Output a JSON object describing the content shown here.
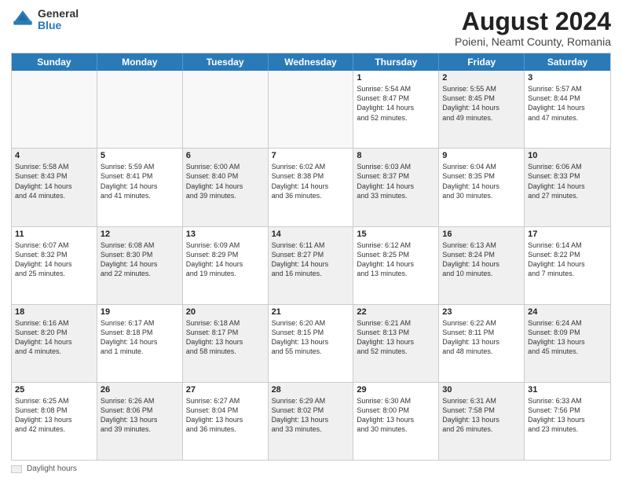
{
  "header": {
    "logo_general": "General",
    "logo_blue": "Blue",
    "month_title": "August 2024",
    "subtitle": "Poieni, Neamt County, Romania"
  },
  "days_of_week": [
    "Sunday",
    "Monday",
    "Tuesday",
    "Wednesday",
    "Thursday",
    "Friday",
    "Saturday"
  ],
  "rows": [
    {
      "cells": [
        {
          "day": "",
          "text": "",
          "empty": true
        },
        {
          "day": "",
          "text": "",
          "empty": true
        },
        {
          "day": "",
          "text": "",
          "empty": true
        },
        {
          "day": "",
          "text": "",
          "empty": true
        },
        {
          "day": "1",
          "text": "Sunrise: 5:54 AM\nSunset: 8:47 PM\nDaylight: 14 hours\nand 52 minutes.",
          "shaded": false
        },
        {
          "day": "2",
          "text": "Sunrise: 5:55 AM\nSunset: 8:45 PM\nDaylight: 14 hours\nand 49 minutes.",
          "shaded": true
        },
        {
          "day": "3",
          "text": "Sunrise: 5:57 AM\nSunset: 8:44 PM\nDaylight: 14 hours\nand 47 minutes.",
          "shaded": false
        }
      ]
    },
    {
      "cells": [
        {
          "day": "4",
          "text": "Sunrise: 5:58 AM\nSunset: 8:43 PM\nDaylight: 14 hours\nand 44 minutes.",
          "shaded": true
        },
        {
          "day": "5",
          "text": "Sunrise: 5:59 AM\nSunset: 8:41 PM\nDaylight: 14 hours\nand 41 minutes.",
          "shaded": false
        },
        {
          "day": "6",
          "text": "Sunrise: 6:00 AM\nSunset: 8:40 PM\nDaylight: 14 hours\nand 39 minutes.",
          "shaded": true
        },
        {
          "day": "7",
          "text": "Sunrise: 6:02 AM\nSunset: 8:38 PM\nDaylight: 14 hours\nand 36 minutes.",
          "shaded": false
        },
        {
          "day": "8",
          "text": "Sunrise: 6:03 AM\nSunset: 8:37 PM\nDaylight: 14 hours\nand 33 minutes.",
          "shaded": true
        },
        {
          "day": "9",
          "text": "Sunrise: 6:04 AM\nSunset: 8:35 PM\nDaylight: 14 hours\nand 30 minutes.",
          "shaded": false
        },
        {
          "day": "10",
          "text": "Sunrise: 6:06 AM\nSunset: 8:33 PM\nDaylight: 14 hours\nand 27 minutes.",
          "shaded": true
        }
      ]
    },
    {
      "cells": [
        {
          "day": "11",
          "text": "Sunrise: 6:07 AM\nSunset: 8:32 PM\nDaylight: 14 hours\nand 25 minutes.",
          "shaded": false
        },
        {
          "day": "12",
          "text": "Sunrise: 6:08 AM\nSunset: 8:30 PM\nDaylight: 14 hours\nand 22 minutes.",
          "shaded": true
        },
        {
          "day": "13",
          "text": "Sunrise: 6:09 AM\nSunset: 8:29 PM\nDaylight: 14 hours\nand 19 minutes.",
          "shaded": false
        },
        {
          "day": "14",
          "text": "Sunrise: 6:11 AM\nSunset: 8:27 PM\nDaylight: 14 hours\nand 16 minutes.",
          "shaded": true
        },
        {
          "day": "15",
          "text": "Sunrise: 6:12 AM\nSunset: 8:25 PM\nDaylight: 14 hours\nand 13 minutes.",
          "shaded": false
        },
        {
          "day": "16",
          "text": "Sunrise: 6:13 AM\nSunset: 8:24 PM\nDaylight: 14 hours\nand 10 minutes.",
          "shaded": true
        },
        {
          "day": "17",
          "text": "Sunrise: 6:14 AM\nSunset: 8:22 PM\nDaylight: 14 hours\nand 7 minutes.",
          "shaded": false
        }
      ]
    },
    {
      "cells": [
        {
          "day": "18",
          "text": "Sunrise: 6:16 AM\nSunset: 8:20 PM\nDaylight: 14 hours\nand 4 minutes.",
          "shaded": true
        },
        {
          "day": "19",
          "text": "Sunrise: 6:17 AM\nSunset: 8:18 PM\nDaylight: 14 hours\nand 1 minute.",
          "shaded": false
        },
        {
          "day": "20",
          "text": "Sunrise: 6:18 AM\nSunset: 8:17 PM\nDaylight: 13 hours\nand 58 minutes.",
          "shaded": true
        },
        {
          "day": "21",
          "text": "Sunrise: 6:20 AM\nSunset: 8:15 PM\nDaylight: 13 hours\nand 55 minutes.",
          "shaded": false
        },
        {
          "day": "22",
          "text": "Sunrise: 6:21 AM\nSunset: 8:13 PM\nDaylight: 13 hours\nand 52 minutes.",
          "shaded": true
        },
        {
          "day": "23",
          "text": "Sunrise: 6:22 AM\nSunset: 8:11 PM\nDaylight: 13 hours\nand 48 minutes.",
          "shaded": false
        },
        {
          "day": "24",
          "text": "Sunrise: 6:24 AM\nSunset: 8:09 PM\nDaylight: 13 hours\nand 45 minutes.",
          "shaded": true
        }
      ]
    },
    {
      "cells": [
        {
          "day": "25",
          "text": "Sunrise: 6:25 AM\nSunset: 8:08 PM\nDaylight: 13 hours\nand 42 minutes.",
          "shaded": false
        },
        {
          "day": "26",
          "text": "Sunrise: 6:26 AM\nSunset: 8:06 PM\nDaylight: 13 hours\nand 39 minutes.",
          "shaded": true
        },
        {
          "day": "27",
          "text": "Sunrise: 6:27 AM\nSunset: 8:04 PM\nDaylight: 13 hours\nand 36 minutes.",
          "shaded": false
        },
        {
          "day": "28",
          "text": "Sunrise: 6:29 AM\nSunset: 8:02 PM\nDaylight: 13 hours\nand 33 minutes.",
          "shaded": true
        },
        {
          "day": "29",
          "text": "Sunrise: 6:30 AM\nSunset: 8:00 PM\nDaylight: 13 hours\nand 30 minutes.",
          "shaded": false
        },
        {
          "day": "30",
          "text": "Sunrise: 6:31 AM\nSunset: 7:58 PM\nDaylight: 13 hours\nand 26 minutes.",
          "shaded": true
        },
        {
          "day": "31",
          "text": "Sunrise: 6:33 AM\nSunset: 7:56 PM\nDaylight: 13 hours\nand 23 minutes.",
          "shaded": false
        }
      ]
    }
  ],
  "footer": {
    "legend_label": "Daylight hours"
  }
}
